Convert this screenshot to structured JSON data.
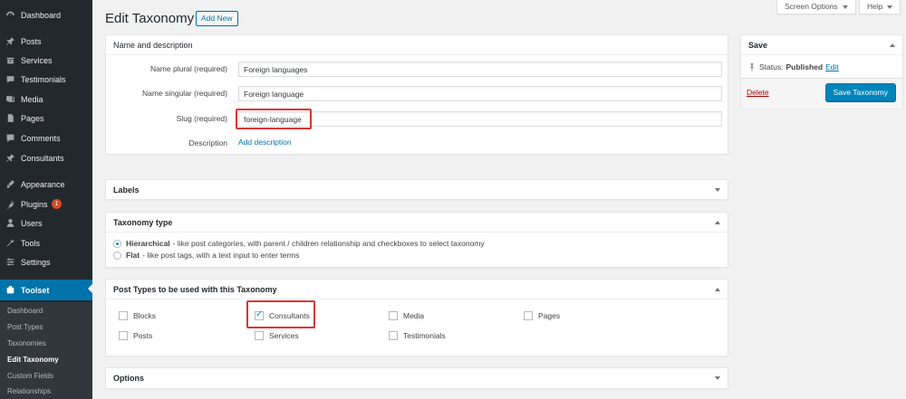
{
  "sidebar": {
    "items": [
      {
        "label": "Dashboard",
        "icon": "dashboard-icon"
      },
      {
        "label": "Posts",
        "icon": "pin-icon"
      },
      {
        "label": "Services",
        "icon": "box-icon"
      },
      {
        "label": "Testimonials",
        "icon": "quote-icon"
      },
      {
        "label": "Media",
        "icon": "media-icon"
      },
      {
        "label": "Pages",
        "icon": "page-icon"
      },
      {
        "label": "Comments",
        "icon": "comment-icon"
      },
      {
        "label": "Consultants",
        "icon": "pin-icon"
      },
      {
        "label": "Appearance",
        "icon": "brush-icon"
      },
      {
        "label": "Plugins",
        "icon": "plugin-icon",
        "badge": "1"
      },
      {
        "label": "Users",
        "icon": "user-icon"
      },
      {
        "label": "Tools",
        "icon": "wrench-icon"
      },
      {
        "label": "Settings",
        "icon": "settings-icon"
      },
      {
        "label": "Toolset",
        "icon": "toolset-icon"
      }
    ],
    "submenu": [
      "Dashboard",
      "Post Types",
      "Taxonomies",
      "Edit Taxonomy",
      "Custom Fields",
      "Relationships"
    ]
  },
  "header": {
    "title": "Edit Taxonomy",
    "add_new": "Add New",
    "screen_options": "Screen Options",
    "help": "Help"
  },
  "name_box": {
    "title": "Name and description",
    "plural_label": "Name plural",
    "singular_label": "Name singular",
    "slug_label": "Slug",
    "required": "(required)",
    "description_label": "Description",
    "plural_value": "Foreign languages",
    "singular_value": "Foreign language",
    "slug_value": "foreign-language",
    "add_description": "Add description"
  },
  "labels_box": {
    "title": "Labels"
  },
  "taxonomy_type": {
    "title": "Taxonomy type",
    "hierarchical_label": "Hierarchical",
    "hierarchical_desc": "- like post categories, with parent / children relationship and checkboxes to select taxonomy",
    "flat_label": "Flat",
    "flat_desc": "- like post tags, with a text input to enter terms",
    "selected": "hierarchical"
  },
  "post_types": {
    "title": "Post Types to be used with this Taxonomy",
    "items": [
      {
        "label": "Blocks",
        "checked": false
      },
      {
        "label": "Consultants",
        "checked": true
      },
      {
        "label": "Media",
        "checked": false
      },
      {
        "label": "Pages",
        "checked": false
      },
      {
        "label": "Posts",
        "checked": false
      },
      {
        "label": "Services",
        "checked": false
      },
      {
        "label": "Testimonials",
        "checked": false
      }
    ]
  },
  "options_box": {
    "title": "Options"
  },
  "save_box": {
    "title": "Save",
    "status_label": "Status:",
    "status_value": "Published",
    "edit_link": "Edit",
    "delete": "Delete",
    "save_button": "Save Taxonomy"
  },
  "colors": {
    "sidebar": "#23282d",
    "accent": "#0073aa",
    "highlight": "#dd3333"
  }
}
